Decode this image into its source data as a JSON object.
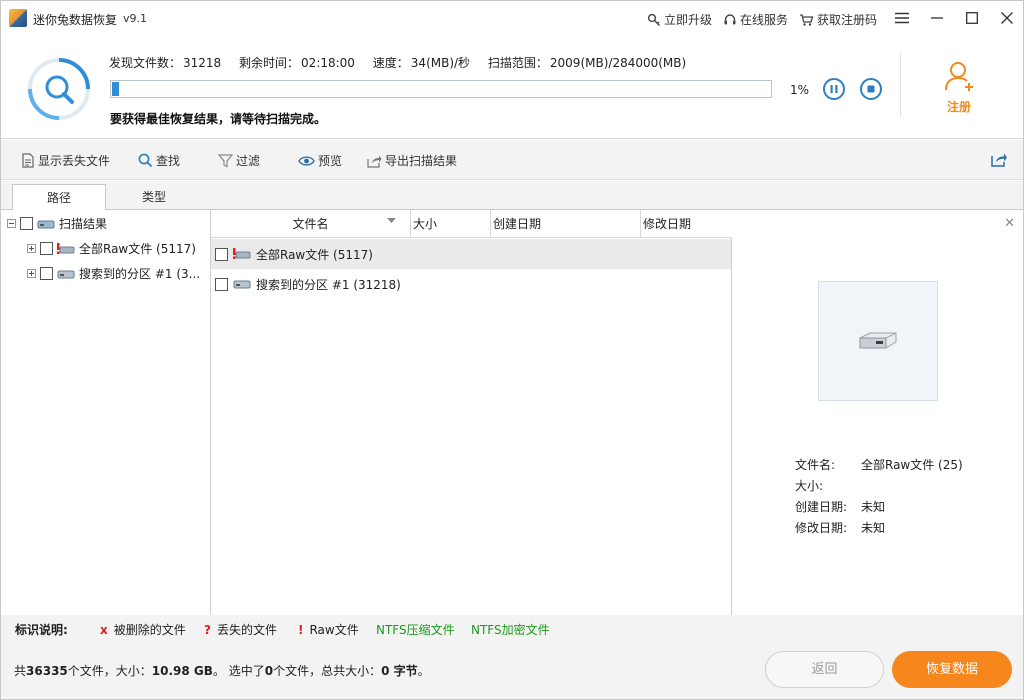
{
  "window": {
    "title": "迷你兔数据恢复",
    "version": "v9.1",
    "links": {
      "upgrade": "立即升级",
      "online_service": "在线服务",
      "get_code": "获取注册码"
    }
  },
  "scan": {
    "found_label": "发现文件数：",
    "found_value": "31218",
    "remaining_label": "剩余时间：",
    "remaining_value": "02:18:00",
    "speed_label": "速度：",
    "speed_value": "34(MB)/秒",
    "range_label": "扫描范围：",
    "range_value": "2009(MB)/284000(MB)",
    "progress_text": "1%",
    "progress_fraction": 0.01,
    "hint": "要获得最佳恢复结果，请等待扫描完成。",
    "register_label": "注册"
  },
  "toolbar": {
    "show_lost": "显示丢失文件",
    "find": "查找",
    "filter": "过滤",
    "preview": "预览",
    "export": "导出扫描结果"
  },
  "tabs": [
    "路径",
    "类型"
  ],
  "tree": {
    "root": "扫描结果",
    "items": [
      "全部Raw文件 (5117)",
      "搜索到的分区 #1 (3..."
    ]
  },
  "list": {
    "columns": [
      "文件名",
      "大小",
      "创建日期",
      "修改日期"
    ],
    "rows": [
      "全部Raw文件 (5117)",
      "搜索到的分区 #1 (31218)"
    ]
  },
  "preview": {
    "name_label": "文件名:",
    "name_value": "全部Raw文件 (25)",
    "size_label": "大小:",
    "size_value": "",
    "created_label": "创建日期:",
    "created_value": "未知",
    "modified_label": "修改日期:",
    "modified_value": "未知"
  },
  "legend": {
    "title": "标识说明:",
    "deleted_mark": "x",
    "deleted": "被删除的文件",
    "lost_mark": "?",
    "lost": "丢失的文件",
    "raw_mark": "!",
    "raw": "Raw文件",
    "ntfs_compressed": "NTFS压缩文件",
    "ntfs_encrypted": "NTFS加密文件"
  },
  "status": {
    "p1": "共",
    "total_files": "36335",
    "p2": "个文件，大小：",
    "total_size": "10.98 GB",
    "p3": "。 选中了",
    "selected_count": "0",
    "p4": "个文件，总共大小：",
    "selected_size": "0 字节",
    "p5": "。",
    "back_button": "返回",
    "recover_button": "恢复数据"
  },
  "colors": {
    "accent_blue": "#2d7fc1",
    "accent_orange": "#f7861c",
    "deleted_red": "#e02020",
    "ntfs_green": "#1d9a1d"
  }
}
